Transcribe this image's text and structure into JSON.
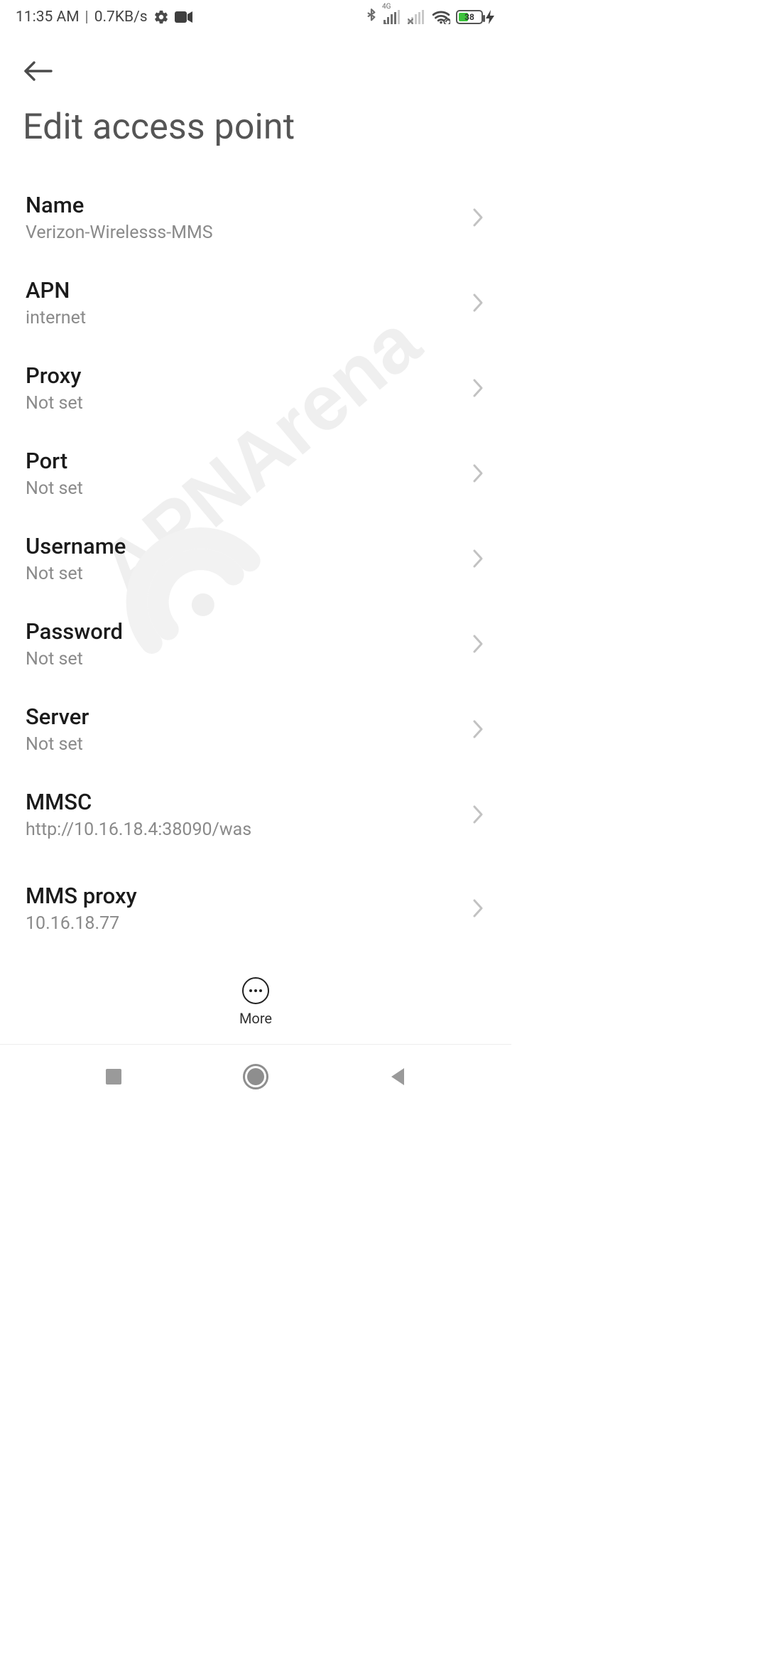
{
  "status": {
    "time": "11:35 AM",
    "net_speed": "0.7KB/s",
    "signal_tag": "4G",
    "battery_pct": "38"
  },
  "header": {
    "title": "Edit access point"
  },
  "fields": [
    {
      "label": "Name",
      "value": "Verizon-Wirelesss-MMS"
    },
    {
      "label": "APN",
      "value": "internet"
    },
    {
      "label": "Proxy",
      "value": "Not set"
    },
    {
      "label": "Port",
      "value": "Not set"
    },
    {
      "label": "Username",
      "value": "Not set"
    },
    {
      "label": "Password",
      "value": "Not set"
    },
    {
      "label": "Server",
      "value": "Not set"
    },
    {
      "label": "MMSC",
      "value": "http://10.16.18.4:38090/was"
    },
    {
      "label": "MMS proxy",
      "value": "10.16.18.77"
    }
  ],
  "action": {
    "more_label": "More"
  }
}
